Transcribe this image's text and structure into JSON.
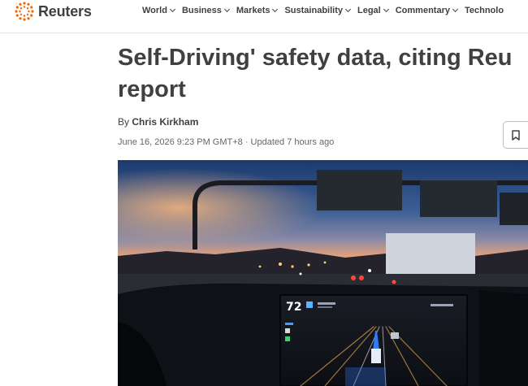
{
  "brand": {
    "name": "Reuters",
    "accent": "#fa6400"
  },
  "nav": {
    "items": [
      {
        "label": "World"
      },
      {
        "label": "Business"
      },
      {
        "label": "Markets"
      },
      {
        "label": "Sustainability"
      },
      {
        "label": "Legal"
      },
      {
        "label": "Commentary"
      },
      {
        "label": "Technolo"
      }
    ]
  },
  "article": {
    "headline_line1": "Self-Driving' safety data, citing Reu",
    "headline_line2": "report",
    "byline_prefix": "By",
    "author": "Chris Kirkham",
    "date": "June 16, 2026 9:23 PM GMT+8 · Updated 7 hours ago",
    "bookmark_icon": "bookmark-icon"
  },
  "hero_image": {
    "dashboard_speed": "72"
  }
}
